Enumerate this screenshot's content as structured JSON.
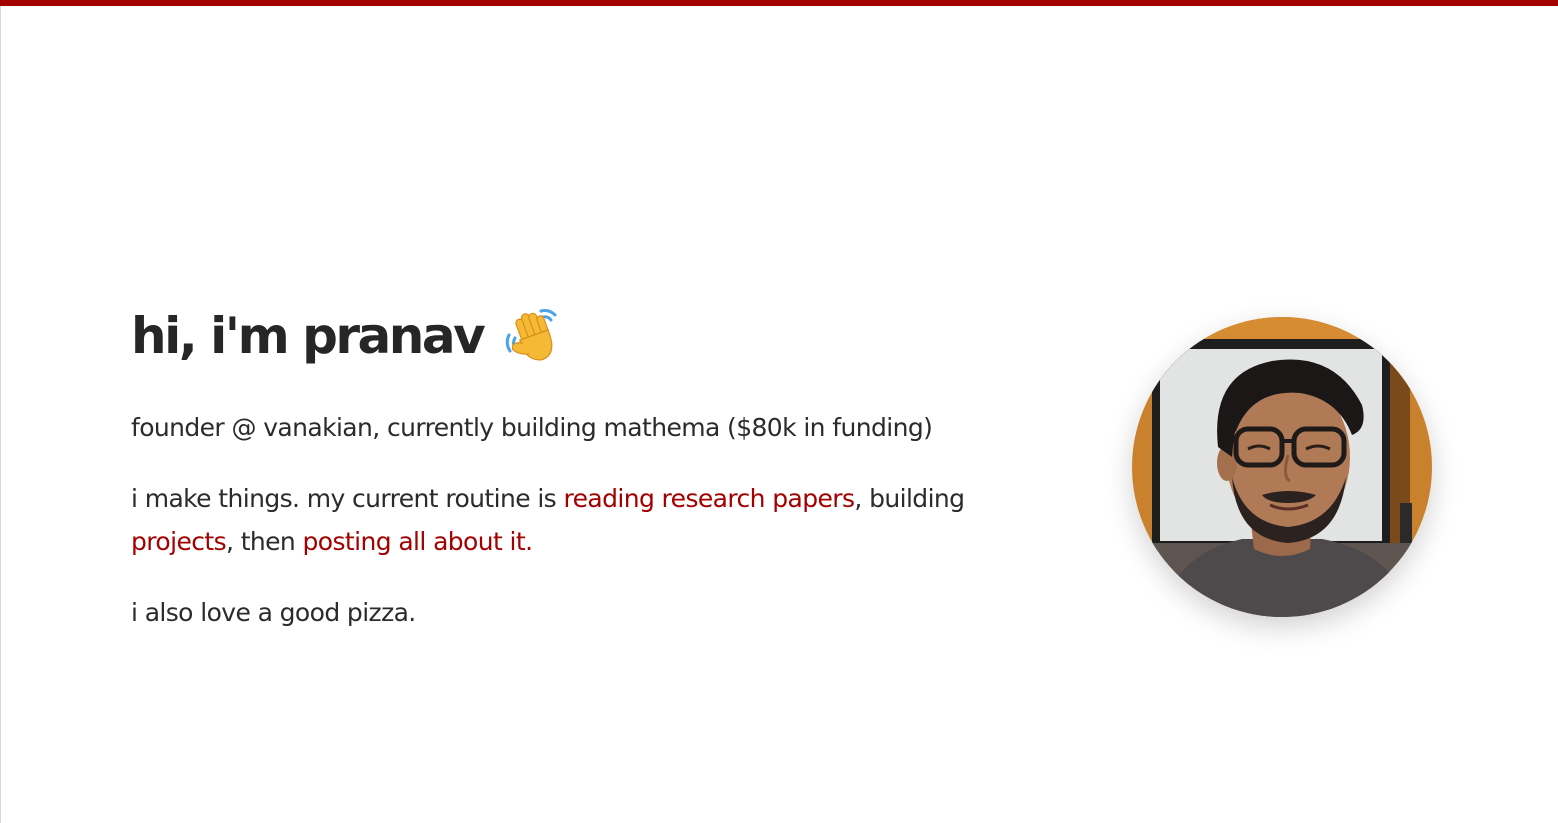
{
  "hero": {
    "title": "hi, i'm pranav",
    "wave_icon": "waving-hand-icon"
  },
  "bio": {
    "line1": "founder @ vanakian, currently building mathema ($80k in funding)",
    "line2_before": "i make things. my current routine is ",
    "link_papers": "reading research papers",
    "line2_mid": ", building ",
    "link_projects": "projects",
    "line2_then": ", then ",
    "link_posting": "posting all about it.",
    "line3": "i also love a good pizza."
  },
  "colors": {
    "accent": "#a30000",
    "text": "#2b2b2b",
    "background": "#ffffff"
  },
  "portrait": {
    "icon": "profile-photo"
  }
}
